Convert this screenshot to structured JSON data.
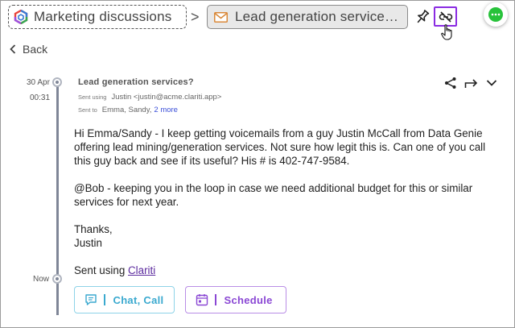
{
  "header": {
    "root_crumb": "Marketing discussions",
    "separator": ">",
    "current_crumb": "Lead generation service…",
    "icons": {
      "app": "clariti-logo-icon",
      "email": "email-icon",
      "pin": "pin-icon",
      "unlink": "unlink-icon",
      "chat": "chat-bubble-icon"
    }
  },
  "nav": {
    "back_label": "Back"
  },
  "timeline": {
    "date": "30 Apr",
    "time": "00:31",
    "now_label": "Now"
  },
  "message": {
    "subject": "Lead generation services?",
    "sent_using_key": "Sent using",
    "sent_using_value": "Justin <justin@acme.clariti.app>",
    "sent_to_key": "Sent to",
    "sent_to_value": "Emma, Sandy,",
    "sent_to_more": "2 more",
    "body": {
      "p1": "Hi Emma/Sandy - I keep getting voicemails from a guy Justin McCall from Data Genie offering lead mining/generation services. Not sure how legit this is. Can one of you call this guy back and see if its useful? His # is 402-747-9584.",
      "p2": "@Bob - keeping you in the loop in case we need additional budget for this or similar services for next year.",
      "p3_line1": "Thanks,",
      "p3_line2": "Justin",
      "p4_prefix": "Sent using ",
      "p4_link": "Clariti"
    }
  },
  "buttons": {
    "chat_call": "Chat, Call",
    "schedule": "Schedule"
  },
  "colors": {
    "accent_purple": "#8a2be2",
    "chat_cyan": "#3aa9cf",
    "schedule_purple": "#8a47d4",
    "status_green": "#27c23a"
  }
}
